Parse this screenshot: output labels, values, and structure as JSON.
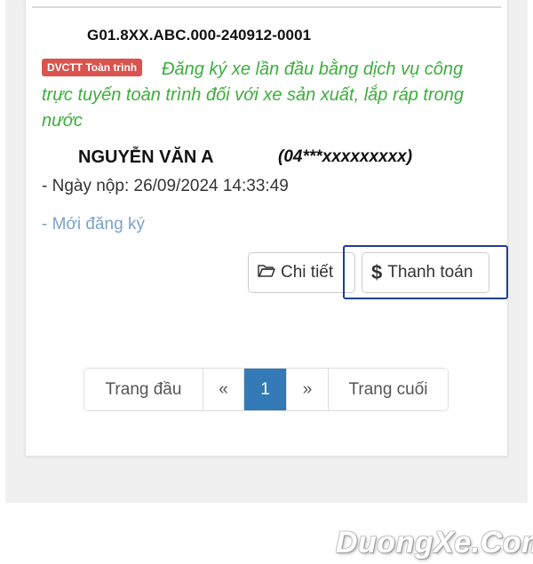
{
  "record": {
    "code": "G01.8XX.ABC.000-240912-0001",
    "badge": "DVCTT Toàn trình",
    "service_line1": "Đăng ký xe lần đầu bằng dịch vụ công",
    "service_line2": "trực tuyến toàn trình đối với xe sản xuất, lắp ráp trong nước",
    "owner_name": "NGUYỄN VĂN A",
    "owner_id": "(04***xxxxxxxxx)",
    "submitted": "- Ngày nộp: 26/09/2024 14:33:49",
    "status": "- Mới đăng ký"
  },
  "actions": {
    "detail_label": "Chi tiết",
    "detail_icon": "folder-open-icon",
    "pay_label": "Thanh toán",
    "pay_icon": "dollar-icon"
  },
  "pagination": {
    "first": "Trang đầu",
    "prev": "«",
    "current": "1",
    "next": "»",
    "last": "Trang cuối"
  },
  "watermark": "DuongXe.Com",
  "colors": {
    "badge": "#d9534f",
    "service_text": "#3cae3c",
    "status_text": "#7aa3cc",
    "active_page": "#337ab7",
    "highlight_border": "#1f3f8f"
  }
}
